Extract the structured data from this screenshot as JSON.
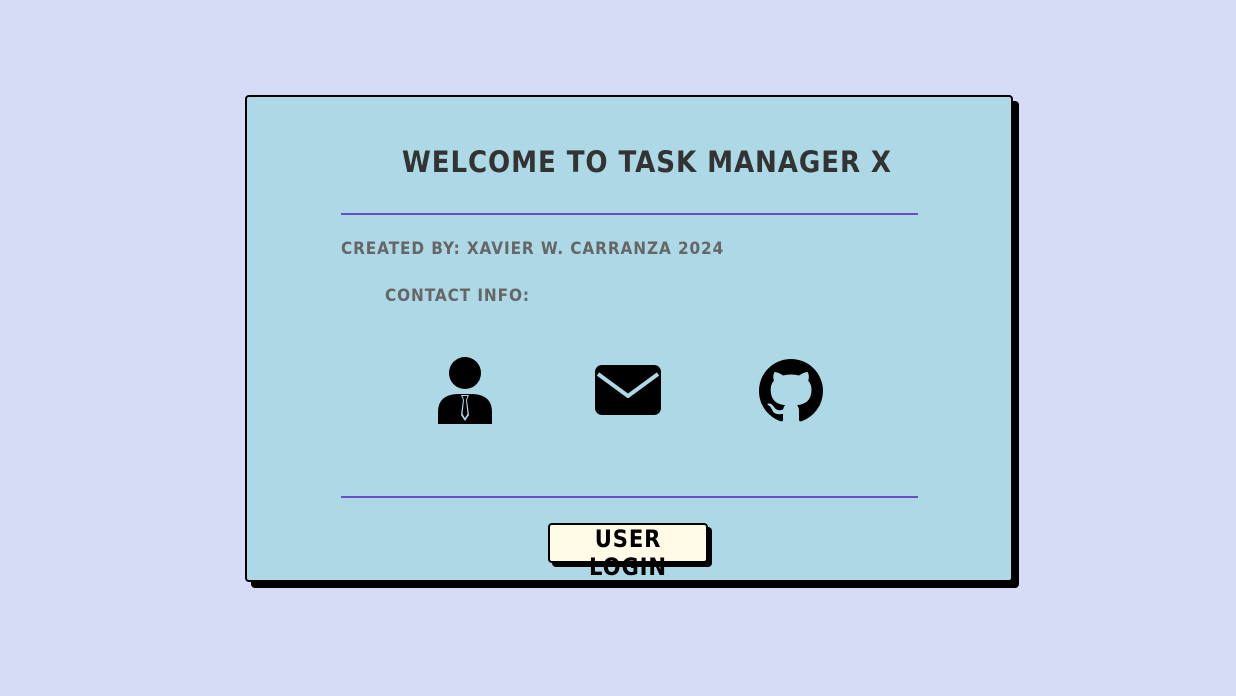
{
  "card": {
    "title": "WELCOME TO TASK MANAGER X",
    "credits": "CREATED BY: XAVIER W. CARRANZA 2024",
    "contact_label": "CONTACT INFO:"
  },
  "contact_icons": [
    {
      "icon": "person-icon"
    },
    {
      "icon": "envelope-icon"
    },
    {
      "icon": "github-icon"
    }
  ],
  "login_button": {
    "label": "USER LOGIN"
  },
  "colors": {
    "page_background": "#d6dcf6",
    "card_background": "#add8e6",
    "divider": "#6a4fc8",
    "button_background": "#fffbe6"
  }
}
